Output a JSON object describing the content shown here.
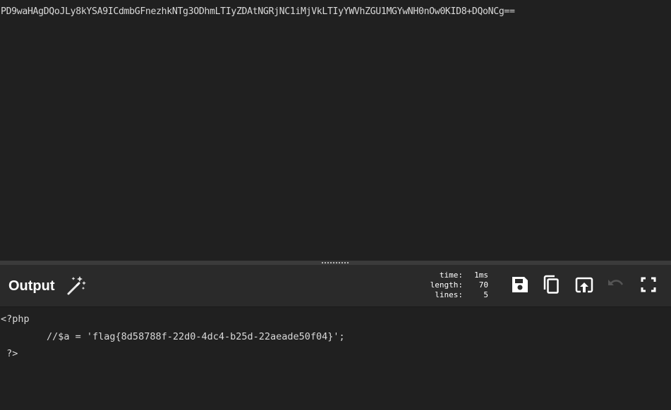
{
  "input": {
    "text": "PD9waHAgDQoJLy8kYSA9ICdmbGFnezhkNTg3ODhmLTIyZDAtNGRjNC1iMjVkLTIyYWVhZGU1MGYwNH0nOw0KID8+DQoNCg=="
  },
  "output": {
    "title": "Output",
    "stats": {
      "time_label": "time:",
      "time_value": "1ms",
      "length_label": "length:",
      "length_value": "70",
      "lines_label": "lines:",
      "lines_value": "5"
    },
    "lines": [
      "<?php",
      "        //$a = 'flag{8d58788f-22d0-4dc4-b25d-22aeade50f04}';",
      " ?>"
    ]
  },
  "icons": {
    "magic": "magic-wand-icon",
    "save": "save-icon",
    "copy": "copy-icon",
    "replace_input": "replace-input-icon",
    "undo": "undo-icon",
    "maximise": "maximise-icon"
  },
  "colors": {
    "background": "#202020",
    "header": "#2a2a2a",
    "text": "#d9d9d9",
    "icon": "#ffffff",
    "disabled_icon": "#555555"
  }
}
